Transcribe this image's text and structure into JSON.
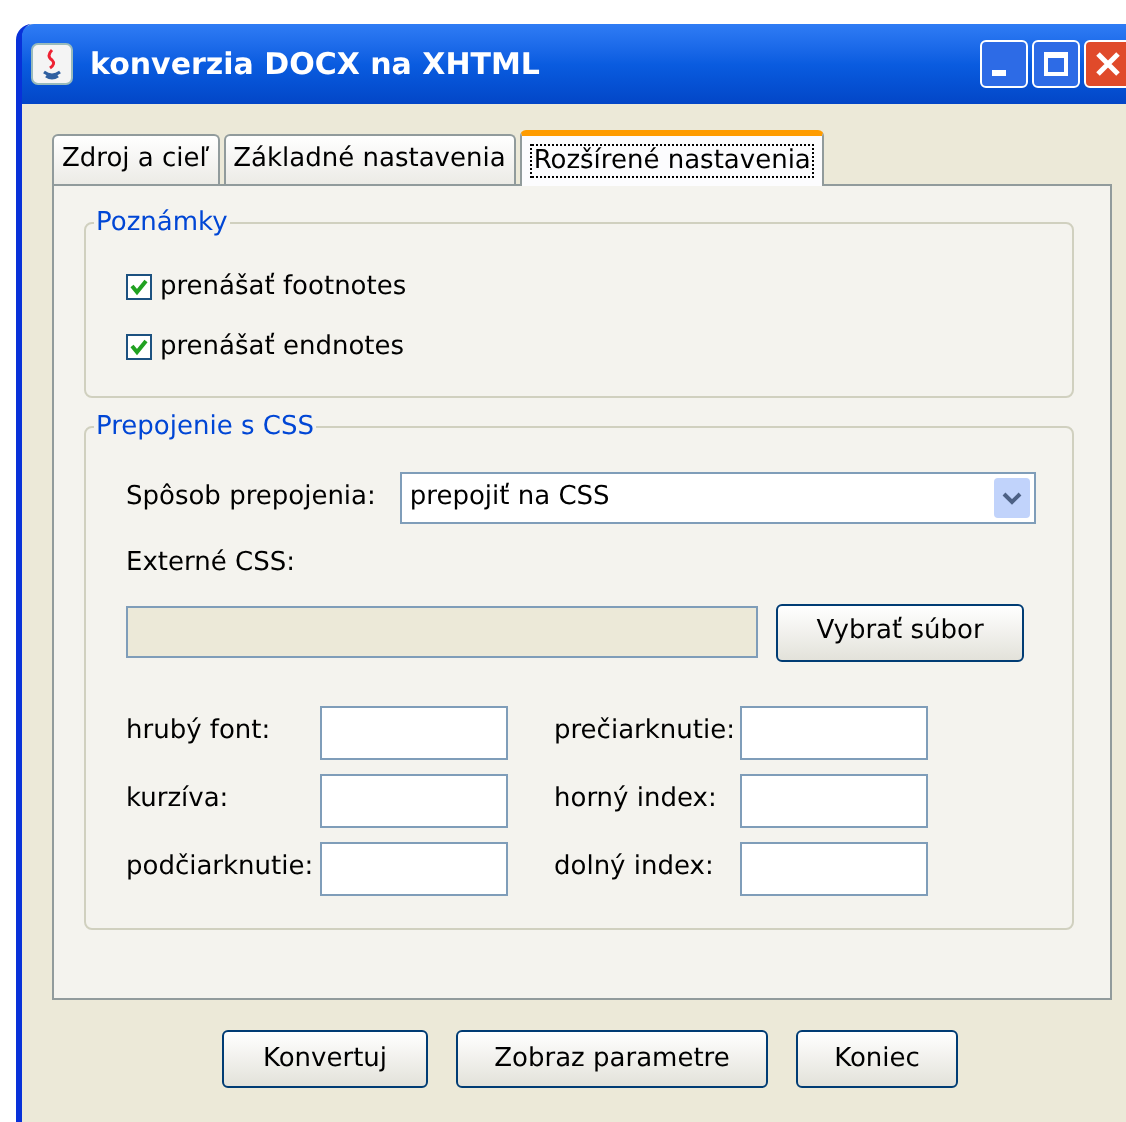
{
  "window": {
    "title": "konverzia DOCX na XHTML"
  },
  "tabs": [
    {
      "label": "Zdroj a cieľ",
      "selected": false
    },
    {
      "label": "Základné nastavenia",
      "selected": false
    },
    {
      "label": "Rozšírené nastavenia",
      "selected": true
    }
  ],
  "notes_group": {
    "title": "Poznámky",
    "options": [
      {
        "label": "prenášať footnotes",
        "checked": true
      },
      {
        "label": "prenášať endnotes",
        "checked": true
      }
    ]
  },
  "css_group": {
    "title": "Prepojenie s CSS",
    "link_mode": {
      "label": "Spôsob prepojenia:",
      "value": "prepojiť na CSS"
    },
    "external_css": {
      "label": "Externé CSS:",
      "browse_button": "Vybrať súbor"
    },
    "styles": [
      {
        "label": "hrubý font:"
      },
      {
        "label": "prečiarknutie:"
      },
      {
        "label": "kurzíva:"
      },
      {
        "label": "horný index:"
      },
      {
        "label": "podčiarknutie:"
      },
      {
        "label": "dolný index:"
      }
    ]
  },
  "buttons": [
    "Konvertuj",
    "Zobraz parametre",
    "Koniec"
  ]
}
